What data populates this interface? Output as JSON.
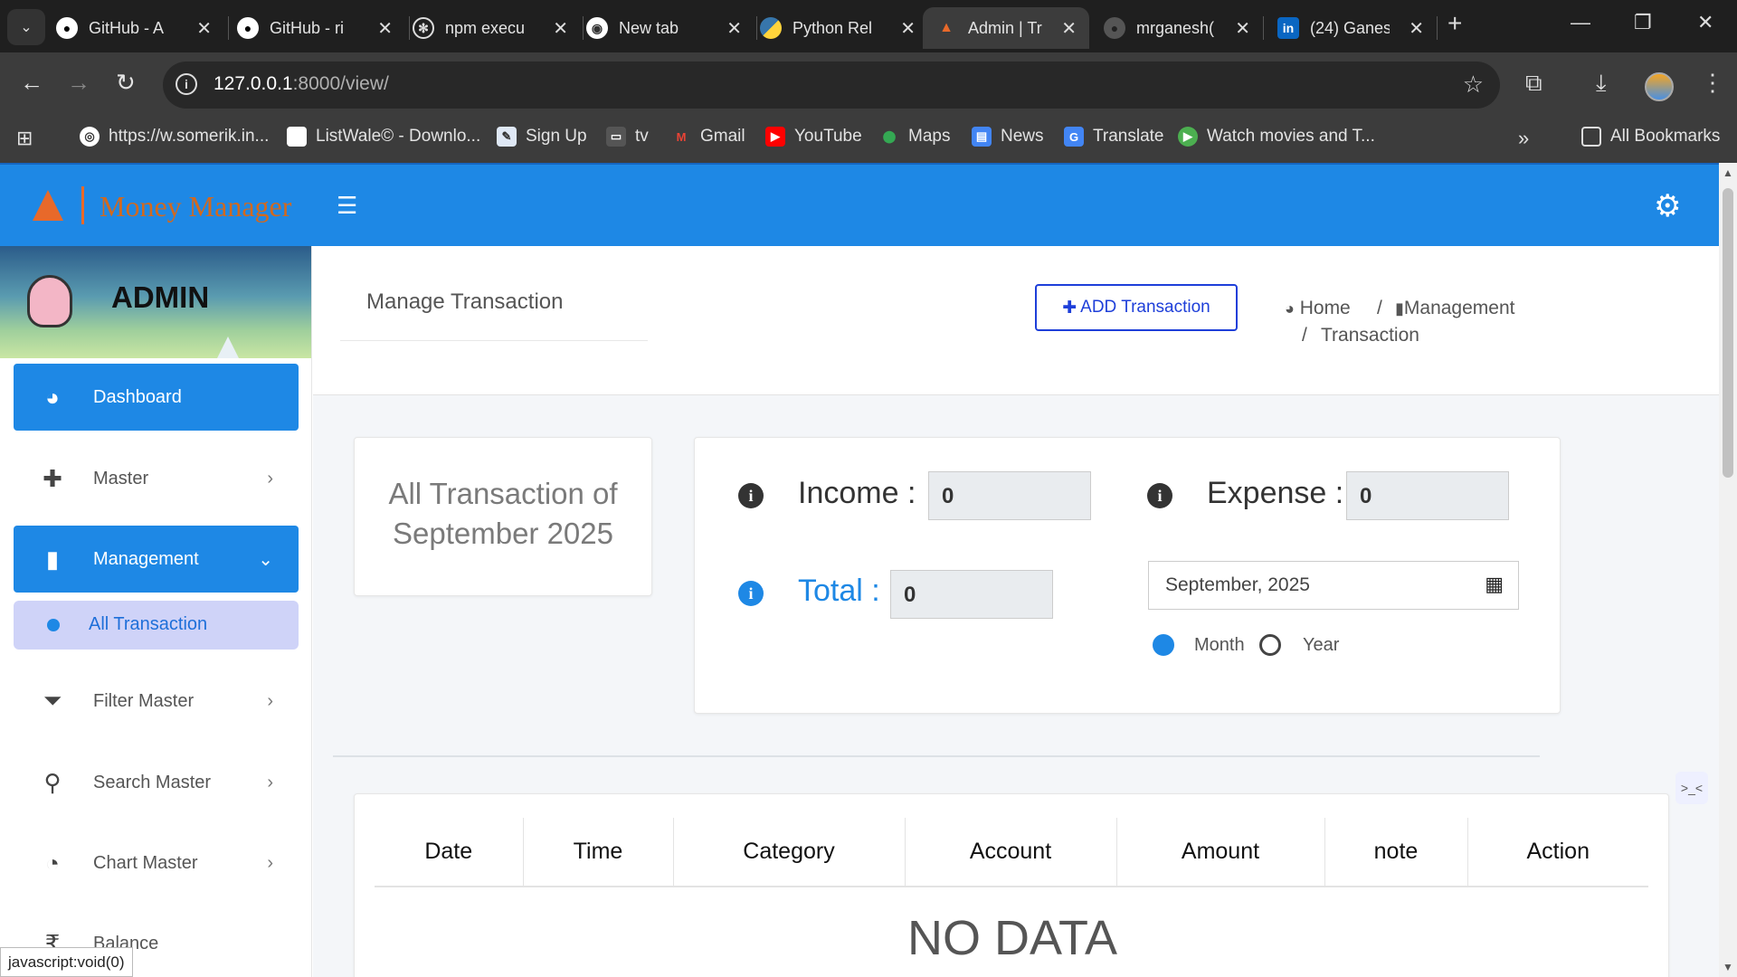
{
  "browser": {
    "tabs": [
      {
        "title": "GitHub - A",
        "icon": "github-icon"
      },
      {
        "title": "GitHub - ri",
        "icon": "github-icon"
      },
      {
        "title": "npm execu",
        "icon": "openai-icon"
      },
      {
        "title": "New tab",
        "icon": "chrome-icon"
      },
      {
        "title": "Python Rel",
        "icon": "python-icon"
      },
      {
        "title": "Admin | Tr",
        "icon": "app-favicon-icon"
      },
      {
        "title": "mrganesh(",
        "icon": "github-icon"
      },
      {
        "title": "(24) Ganes",
        "icon": "linkedin-icon"
      }
    ],
    "url_host": "127.0.0.1",
    "url_path": ":8000/view/",
    "bookmarks": [
      "https://w.somerik.in...",
      "ListWale© - Downlo...",
      "Sign Up",
      "tv",
      "Gmail",
      "YouTube",
      "Maps",
      "News",
      "Translate",
      "Watch movies and T..."
    ],
    "all_bookmarks": "All Bookmarks",
    "status_text": "javascript:void(0)"
  },
  "app": {
    "name": "Money Manager",
    "user": "ADMIN",
    "accent": "#1e88e5"
  },
  "sidebar": {
    "items": [
      {
        "label": "Dashboard",
        "icon": "dashboard-icon"
      },
      {
        "label": "Master",
        "icon": "plus-icon"
      },
      {
        "label": "Management",
        "icon": "file-icon"
      },
      {
        "label": "Filter Master",
        "icon": "filter-icon"
      },
      {
        "label": "Search Master",
        "icon": "search-icon"
      },
      {
        "label": "Chart Master",
        "icon": "pie-chart-icon"
      },
      {
        "label": "Balance",
        "icon": "rupee-icon"
      }
    ],
    "sub_item": "All Transaction"
  },
  "header": {
    "title": "Manage Transaction",
    "add_button": "ADD Transaction",
    "breadcrumb": [
      "Home",
      "Management",
      "Transaction"
    ]
  },
  "summary": {
    "card_title": "All Transaction of September 2025",
    "income_label": "Income :",
    "income_value": "0",
    "expense_label": "Expense :",
    "expense_value": "0",
    "total_label": "Total :",
    "total_value": "0",
    "month_picker": "September, 2025",
    "radio_month": "Month",
    "radio_year": "Year",
    "selected": "Month"
  },
  "table": {
    "columns": [
      "Date",
      "Time",
      "Category",
      "Account",
      "Amount",
      "note",
      "Action"
    ],
    "empty_text": "NO DATA"
  }
}
